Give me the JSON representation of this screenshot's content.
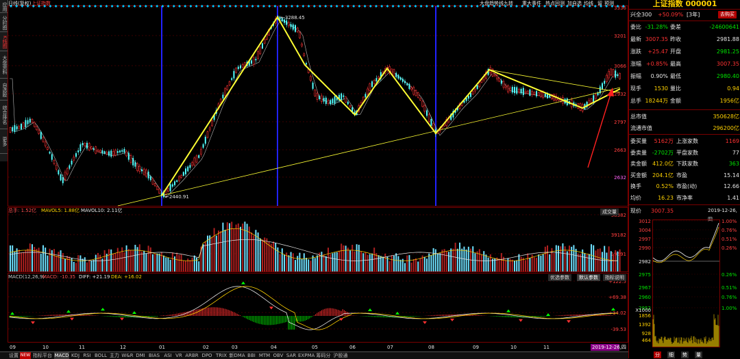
{
  "toolbar": {
    "left_title": "日线(复权)",
    "left_subtitle": "上证指数",
    "right_items": [
      "大盘趋势线九转",
      "重大事件",
      "热点回测",
      "加自选",
      "均线",
      "留",
      "预测"
    ]
  },
  "left_tabs": [
    "应用",
    "分时图",
    "K线图",
    "大盘资料",
    "自选股",
    "综合排名",
    "更多"
  ],
  "left_tab_active": 2,
  "main_chart": {
    "y_ticks": [
      "3336",
      "3201",
      "3066",
      "2932",
      "2797",
      "2663",
      "2632"
    ],
    "current_price_tag": "2632",
    "high_label": "3288.45",
    "low_label": "2440.91",
    "x_ticks": [
      "09",
      "10",
      "11",
      "12",
      "01",
      "02",
      "03",
      "04",
      "05",
      "06",
      "07",
      "08",
      "09",
      "10",
      "11"
    ],
    "date_tag": "2019-12-26,四"
  },
  "volume_panel": {
    "legend": [
      {
        "text": "总手: 1.52亿",
        "color": "#ff5050"
      },
      {
        "text": "MAVOL5: 1.88亿",
        "color": "#ffd200"
      },
      {
        "text": "MAVOL10: 2.11亿",
        "color": "#e6e6e6"
      }
    ],
    "button": "成交量",
    "y_ticks": [
      "58382",
      "39182",
      "19591"
    ]
  },
  "macd_panel": {
    "legend": [
      {
        "text": "MACD(12,26,9)",
        "color": "#c8c8c8"
      },
      {
        "text": "MACD: -10.35",
        "color": "#ff5050"
      },
      {
        "text": "DIFF: +21.19",
        "color": "#e6e6e6"
      },
      {
        "text": "DEA: +16.02",
        "color": "#ffd200"
      }
    ],
    "buttons": [
      "优选参数",
      "默认参数",
      "指标说明"
    ],
    "y_ticks": [
      "+122.5",
      "+69.38",
      "+14.02",
      "-39.53"
    ]
  },
  "bottom_tabs": {
    "items": [
      "设置",
      "NEW",
      "指标平台",
      "MACD",
      "KDJ",
      "RSI",
      "BOLL",
      "主力",
      "W&R",
      "DMI",
      "BIAS",
      "ASI",
      "VR",
      "ARBR",
      "DPO",
      "TRIX",
      "新DMA",
      "BBI",
      "MTM",
      "OBV",
      "SAR",
      "EXPMA",
      "筹码分",
      "沪股通"
    ],
    "active": "MACD"
  },
  "info_panel": {
    "title": "上证指数 000001",
    "row1": {
      "label": "兴全300",
      "value": "+50.09%",
      "period": "[3年]",
      "button": "去购买"
    },
    "rows": [
      {
        "l1": "委比",
        "v1": "-31.28%",
        "c1": "green",
        "l2": "委差",
        "v2": "-24600641",
        "c2": "green"
      },
      {
        "l1": "最新",
        "v1": "3007.35",
        "c1": "red",
        "l2": "昨收",
        "v2": "2981.88",
        "c2": "white"
      },
      {
        "l1": "涨跌",
        "v1": "+25.47",
        "c1": "red",
        "l2": "开盘",
        "v2": "2981.25",
        "c2": "green"
      },
      {
        "l1": "涨幅",
        "v1": "+0.85%",
        "c1": "red",
        "l2": "最高",
        "v2": "3007.35",
        "c2": "red"
      },
      {
        "l1": "振幅",
        "v1": "0.90%",
        "c1": "white",
        "l2": "最低",
        "v2": "2980.40",
        "c2": "green"
      },
      {
        "l1": "现手",
        "v1": "1530",
        "c1": "yellow",
        "l2": "量比",
        "v2": "0.94",
        "c2": "yellow"
      },
      {
        "l1": "总手",
        "v1": "18244万",
        "c1": "yellow",
        "l2": "金额",
        "v2": "1956亿",
        "c2": "yellow"
      }
    ],
    "rows2": [
      {
        "l": "总市值",
        "v": "350628亿",
        "c": "yellow"
      },
      {
        "l": "流通市值",
        "v": "296200亿",
        "c": "yellow"
      }
    ],
    "rows3": [
      {
        "l1": "委买量",
        "v1": "5162万",
        "c1": "red",
        "l2": "上涨家数",
        "v2": "1169",
        "c2": "red"
      },
      {
        "l1": "委卖量",
        "v1": "-2702万",
        "c1": "green",
        "l2": "平盘家数",
        "v2": "77",
        "c2": "white"
      },
      {
        "l1": "卖金额",
        "v1": "412.0亿",
        "c1": "yellow",
        "l2": "下跌家数",
        "v2": "363",
        "c2": "green"
      },
      {
        "l1": "买金额",
        "v1": "204.1亿",
        "c1": "yellow",
        "l2": "市盈",
        "v2": "15.14",
        "c2": "white"
      },
      {
        "l1": "换手",
        "v1": "0.52%",
        "c1": "yellow",
        "l2": "市盈(动)",
        "v2": "12.66",
        "c2": "white"
      },
      {
        "l1": "均价",
        "v1": "16.23",
        "c1": "yellow",
        "l2": "市净率",
        "v2": "1.41",
        "c2": "white"
      }
    ],
    "mini_header": {
      "label": "现价",
      "value": "3007.35",
      "date": "2019-12-26,四"
    },
    "mini_left_ticks": [
      "3012",
      "3004",
      "2997",
      "2990",
      "2982",
      "2975",
      "2967",
      "2960",
      "2952"
    ],
    "mini_right_ticks": [
      "1.00%",
      "0.76%",
      "0.51%",
      "0.26%",
      "0.26%",
      "0.51%",
      "0.76%",
      "1.00%"
    ],
    "mini_vol_ticks": [
      "X1000",
      "1856",
      "1392",
      "928",
      "464"
    ],
    "bottom_buttons": [
      "分",
      "细",
      "势",
      "量"
    ]
  },
  "colors": {
    "up": "#ff3232",
    "down": "#54ffff",
    "trend_yellow": "#ffff33",
    "vline_blue": "#2222ff",
    "grid": "#7a0000"
  }
}
